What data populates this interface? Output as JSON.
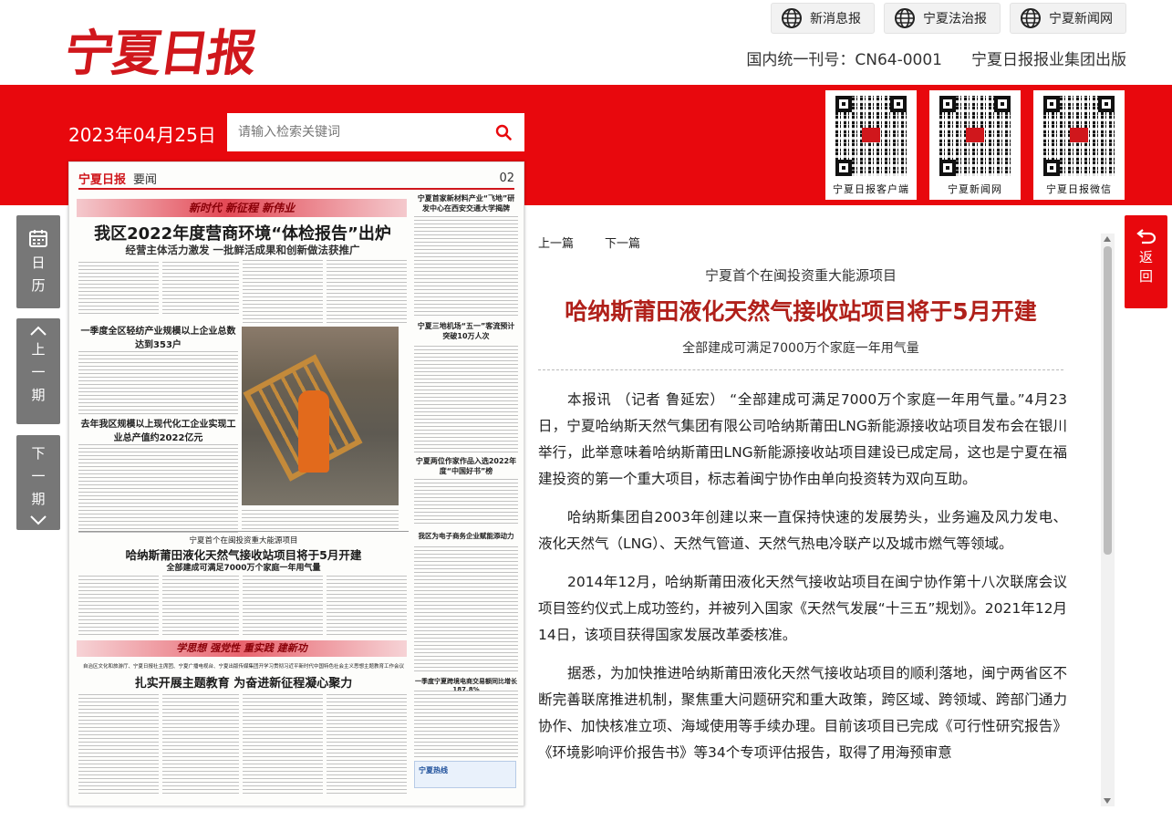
{
  "header": {
    "logo_text": "宁夏日报",
    "links": [
      "新消息报",
      "宁夏法治报",
      "宁夏新闻网"
    ],
    "issn": "国内统一刊号：CN64-0001",
    "publisher": "宁夏日报报业集团出版"
  },
  "toolbar": {
    "date": "2023年04月25日",
    "search_placeholder": "请输入检索关键词"
  },
  "qr_codes": [
    {
      "label": "宁夏日报客户端"
    },
    {
      "label": "宁夏新闻网"
    },
    {
      "label": "宁夏日报微信"
    }
  ],
  "sidenav": {
    "calendar": "日历",
    "prev_issue": "上一期",
    "next_issue": "下一期"
  },
  "back_button": "返回",
  "paper": {
    "logo": "宁夏日报",
    "section": "要闻",
    "page_no": "02",
    "banner": "新时代 新征程 新伟业",
    "headline": "我区2022年度营商环境“体检报告”出炉",
    "headline_sub": "经营主体活力激发 一批鲜活成果和创新做法获推广",
    "side1": "宁夏首家新材料产业“飞地”研发中心在西安交通大学揭牌",
    "story2": "一季度全区轻纺产业规模以上企业总数达到353户",
    "story3": "去年我区规模以上现代化工企业实现工业总产值约2022亿元",
    "side2": "宁夏三地机场“五一”客流预计突破10万人次",
    "side3": "宁夏两位作家作品入选2022年度“中国好书”榜",
    "feature_pre": "宁夏首个在闽投资重大能源项目",
    "feature": "哈纳斯莆田液化天然气接收站项目将于5月开建",
    "feature_sub": "全部建成可满足7000万个家庭一年用气量",
    "side4": "我区为电子商务企业赋能添动力",
    "banner2": "学思想 强党性 重实践 建新功",
    "bottom_pre": "自治区文化和旅游厅、宁夏日报社主席团、宁夏广播电视台、宁夏出版传媒集团开学习贯彻习近平新时代中国特色社会主义思想主题教育工作会议",
    "bottom": "扎实开展主题教育 为奋进新征程凝心聚力",
    "side5": "一季度宁夏跨境电商交易额同比增长187.8%",
    "ad": "宁夏热线"
  },
  "pager": {
    "prev": "上一篇",
    "next": "下一篇"
  },
  "article": {
    "pretitle": "宁夏首个在闽投资重大能源项目",
    "title": "哈纳斯莆田液化天然气接收站项目将于5月开建",
    "subtitle": "全部建成可满足7000万个家庭一年用气量",
    "paragraphs": [
      "本报讯 （记者 鲁延宏） “全部建成可满足7000万个家庭一年用气量。”4月23日，宁夏哈纳斯天然气集团有限公司哈纳斯莆田LNG新能源接收站项目发布会在银川举行，此举意味着哈纳斯莆田LNG新能源接收站项目建设已成定局，这也是宁夏在福建投资的第一个重大项目，标志着闽宁协作由单向投资转为双向互助。",
      "哈纳斯集团自2003年创建以来一直保持快速的发展势头，业务遍及风力发电、液化天然气（LNG）、天然气管道、天然气热电冷联产以及城市燃气等领域。",
      "2014年12月，哈纳斯莆田液化天然气接收站项目在闽宁协作第十八次联席会议项目签约仪式上成功签约，并被列入国家《天然气发展“十三五”规划》。2021年12月14日，该项目获得国家发展改革委核准。",
      "据悉，为加快推进哈纳斯莆田液化天然气接收站项目的顺利落地，闽宁两省区不断完善联席推进机制，聚焦重大问题研究和重大政策，跨区域、跨领域、跨部门通力协作、加快核准立项、海域使用等手续办理。目前该项目已完成《可行性研究报告》《环境影响评价报告书》等34个专项评估报告，取得了用海预审意"
    ]
  }
}
